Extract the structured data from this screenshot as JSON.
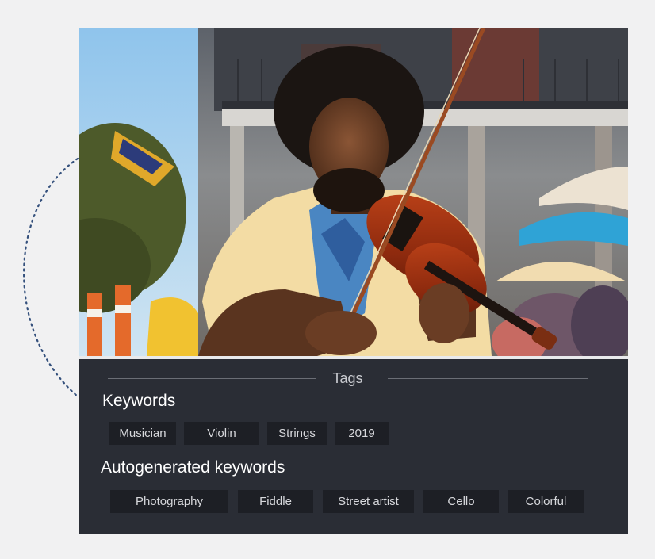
{
  "panel": {
    "header": "Tags",
    "keywords": {
      "title": "Keywords",
      "chips": [
        "Musician",
        "Violin",
        "Strings",
        "2019"
      ]
    },
    "autogenerated": {
      "title": "Autogenerated keywords",
      "chips": [
        "Photography",
        "Fiddle",
        "Street artist",
        "Cello",
        "Colorful"
      ]
    }
  },
  "colors": {
    "page_bg": "#f1f1f2",
    "panel_bg": "#2a2d35",
    "chip_bg": "#1d1f25",
    "arc": "#34507c"
  },
  "photo": {
    "subject": "street violinist photo"
  }
}
